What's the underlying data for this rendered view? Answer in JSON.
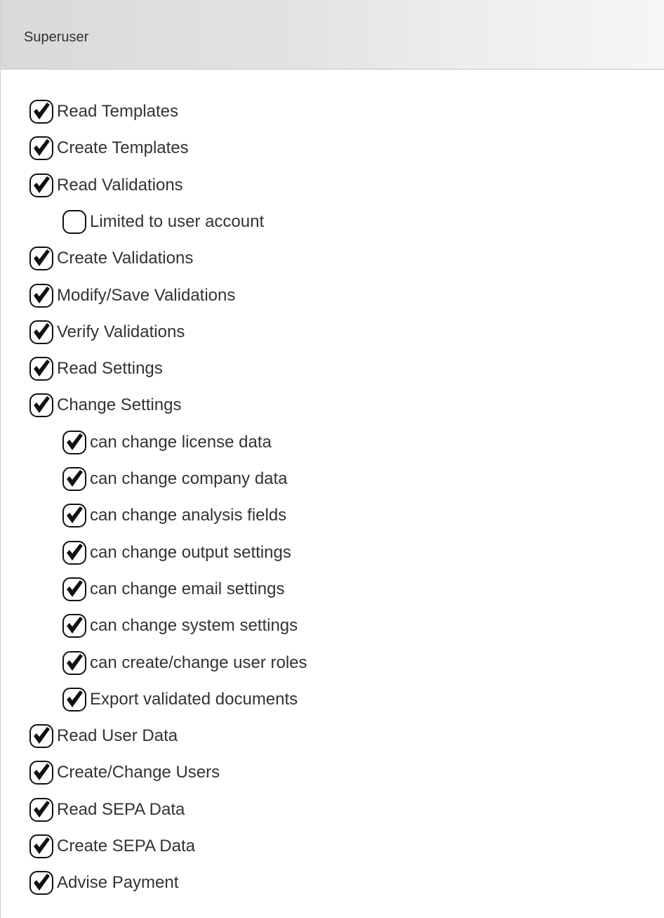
{
  "panel": {
    "title": "Superuser"
  },
  "colors": {
    "header_bg": "#dcdcdc",
    "text": "#333333",
    "checkbox_stroke": "#111111"
  },
  "permissions": [
    {
      "label": "Read Templates",
      "checked": true,
      "level": 0
    },
    {
      "label": "Create Templates",
      "checked": true,
      "level": 0
    },
    {
      "label": "Read Validations",
      "checked": true,
      "level": 0
    },
    {
      "label": "Limited to user account",
      "checked": false,
      "level": 1
    },
    {
      "label": "Create Validations",
      "checked": true,
      "level": 0
    },
    {
      "label": "Modify/Save Validations",
      "checked": true,
      "level": 0
    },
    {
      "label": "Verify Validations",
      "checked": true,
      "level": 0
    },
    {
      "label": "Read Settings",
      "checked": true,
      "level": 0
    },
    {
      "label": "Change Settings",
      "checked": true,
      "level": 0
    },
    {
      "label": "can change license data",
      "checked": true,
      "level": 1
    },
    {
      "label": "can change company data",
      "checked": true,
      "level": 1
    },
    {
      "label": "can change analysis fields",
      "checked": true,
      "level": 1
    },
    {
      "label": "can change output settings",
      "checked": true,
      "level": 1
    },
    {
      "label": "can change email settings",
      "checked": true,
      "level": 1
    },
    {
      "label": "can change system settings",
      "checked": true,
      "level": 1
    },
    {
      "label": "can create/change user roles",
      "checked": true,
      "level": 1
    },
    {
      "label": "Export validated documents",
      "checked": true,
      "level": 1
    },
    {
      "label": "Read User Data",
      "checked": true,
      "level": 0
    },
    {
      "label": "Create/Change Users",
      "checked": true,
      "level": 0
    },
    {
      "label": "Read SEPA Data",
      "checked": true,
      "level": 0
    },
    {
      "label": "Create SEPA Data",
      "checked": true,
      "level": 0
    },
    {
      "label": "Advise Payment",
      "checked": true,
      "level": 0
    }
  ]
}
